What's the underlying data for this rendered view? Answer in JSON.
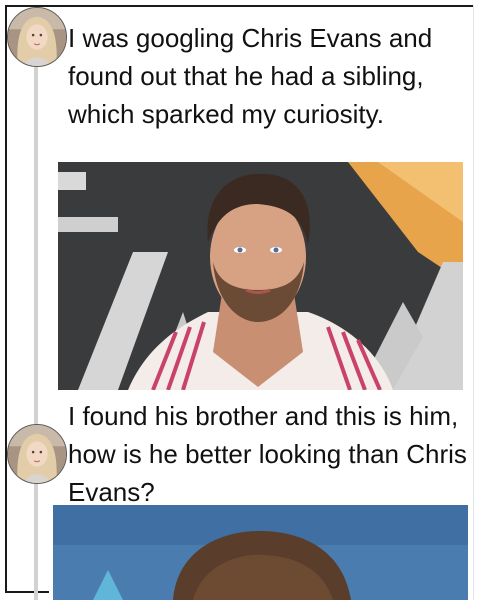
{
  "thread": {
    "messages": [
      {
        "avatar": "user-avatar-icon",
        "text": "I was googling Chris Evans and found out that he had a sibling, which sparked my curiosity."
      },
      {
        "avatar": "user-avatar-icon",
        "text": "I found his brother and this is him, how is he better looking than Chris Evans?"
      }
    ],
    "images": [
      {
        "icon": "photo-of-man-in-striped-shirt"
      },
      {
        "icon": "photo-of-man-cropped"
      }
    ]
  },
  "colors": {
    "frame": "#1a1a1a",
    "thread_line": "#d2d2d2",
    "text": "#111111"
  }
}
